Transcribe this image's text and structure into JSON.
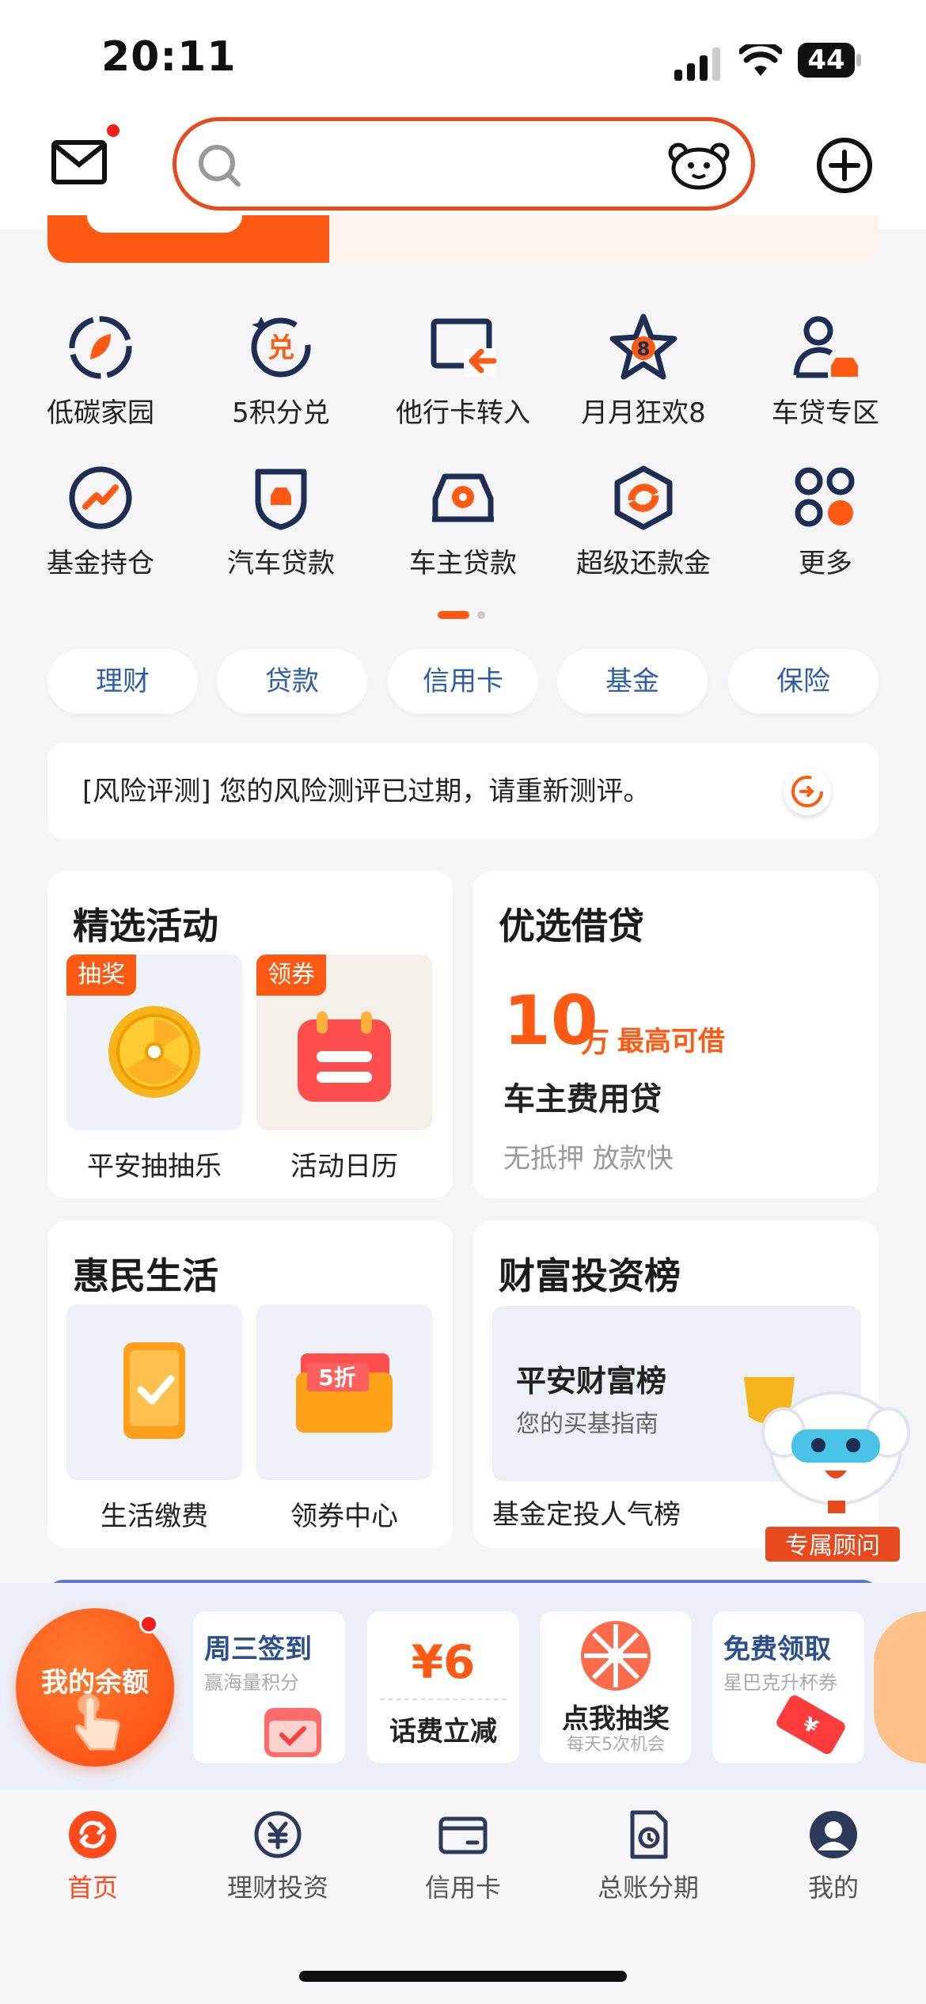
{
  "status_bar": {
    "time": "20:11",
    "battery": "44"
  },
  "header": {
    "search": {
      "placeholder": ""
    }
  },
  "quick_grid": [
    {
      "label": "低碳家园",
      "icon": "leaf-circle-icon"
    },
    {
      "label": "5积分兑",
      "icon": "points-exchange-icon"
    },
    {
      "label": "他行卡转入",
      "icon": "card-transfer-icon"
    },
    {
      "label": "月月狂欢8",
      "icon": "star-8-icon"
    },
    {
      "label": "车贷专区",
      "icon": "car-loan-user-icon"
    },
    {
      "label": "基金持仓",
      "icon": "fund-chart-icon"
    },
    {
      "label": "汽车贷款",
      "icon": "car-shield-icon"
    },
    {
      "label": "车主贷款",
      "icon": "car-owner-icon"
    },
    {
      "label": "超级还款金",
      "icon": "hexagon-repay-icon"
    },
    {
      "label": "更多",
      "icon": "more-grid-icon"
    }
  ],
  "pills": [
    "理财",
    "贷款",
    "信用卡",
    "基金",
    "保险"
  ],
  "notice": {
    "text": "[风险评测] 您的风险测评已过期，请重新测评。"
  },
  "activities": {
    "title": "精选活动",
    "items": [
      {
        "tag": "抽奖",
        "label": "平安抽抽乐"
      },
      {
        "tag": "领券",
        "label": "活动日历"
      }
    ]
  },
  "loan": {
    "title": "优选借贷",
    "amount": "10",
    "unit": "万",
    "note": "最高可借",
    "name": "车主费用贷",
    "desc": "无抵押 放款快"
  },
  "life": {
    "title": "惠民生活",
    "items": [
      {
        "label": "生活缴费"
      },
      {
        "label": "领券中心",
        "badge": "5折"
      }
    ]
  },
  "wealth": {
    "title": "财富投资榜",
    "box_title": "平安财富榜",
    "box_sub": "您的买基指南",
    "footer": "基金定投人气榜"
  },
  "advisor": {
    "label": "专属顾问"
  },
  "promo": {
    "balance": "我的余额",
    "cards": [
      {
        "title": "周三签到",
        "sub": "赢海量积分"
      },
      {
        "price": "¥6",
        "title": "话费立减"
      },
      {
        "title": "点我抽奖",
        "sub": "每天5次机会"
      },
      {
        "title": "免费领取",
        "sub": "星巴克升杯券"
      }
    ]
  },
  "tabbar": [
    {
      "label": "首页",
      "active": true
    },
    {
      "label": "理财投资"
    },
    {
      "label": "信用卡"
    },
    {
      "label": "总账分期"
    },
    {
      "label": "我的"
    }
  ],
  "colors": {
    "accent": "#ff5a14",
    "navy": "#1f2d52",
    "blue_text": "#2f5ea8"
  }
}
